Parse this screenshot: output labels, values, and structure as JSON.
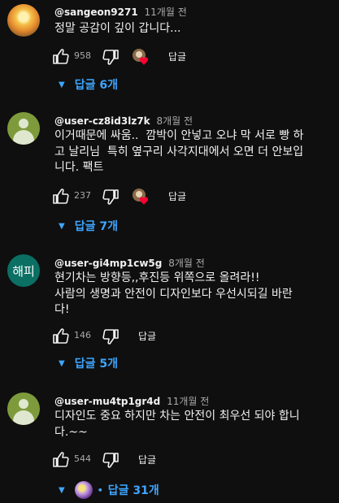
{
  "comments": [
    {
      "handle": "@sangeon9271",
      "time": "11개월 전",
      "text": "정말 공감이 깊이 갑니다...",
      "likes": "958",
      "reply_label": "답글",
      "replies_label": "답글 6개"
    },
    {
      "handle": "@user-cz8id3lz7k",
      "time": "8개월 전",
      "text": "이거때문에 싸움..  깜박이 안넣고 오냐 막 서로 빵 하\n고 날리님  특히 옆구리 사각지대에서 오면 더 안보입\n니다. 팩트",
      "likes": "237",
      "reply_label": "답글",
      "replies_label": "답글 7개"
    },
    {
      "handle": "@user-gi4mp1cw5g",
      "time": "8개월 전",
      "avatar_text": "해피",
      "text": "현기차는 방향등,,후진등 위쪽으로 올려라!!\n사람의 생명과 안전이 디자인보다 우선시되길 바란\n다!",
      "likes": "146",
      "reply_label": "답글",
      "replies_label": "답글 5개"
    },
    {
      "handle": "@user-mu4tp1gr4d",
      "time": "11개월 전",
      "text": "디자인도 중요 하지만 차는 안전이 최우선 되야 합니\n다.~~",
      "likes": "544",
      "reply_label": "답글",
      "replies_label": "답글 31개"
    }
  ],
  "icons": {
    "like": "thumb-up-icon",
    "dislike": "thumb-down-icon",
    "creator_heart": "creator-heart-icon",
    "expand": "chevron-down-icon"
  },
  "colors": {
    "background": "#0f0f0f",
    "link_blue": "#3ea6ff",
    "heart_red": "#ff0033",
    "muted": "#aaaaaa"
  }
}
